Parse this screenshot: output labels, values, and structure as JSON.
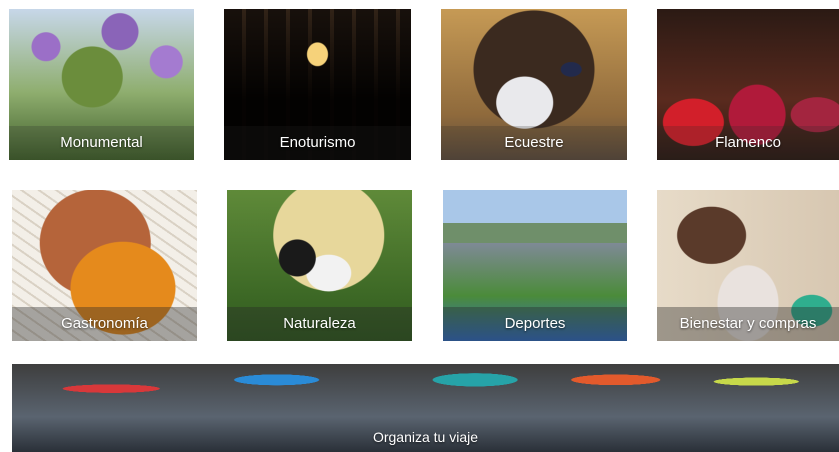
{
  "tiles": [
    {
      "id": "monumental",
      "label": "Monumental"
    },
    {
      "id": "enoturismo",
      "label": "Enoturismo"
    },
    {
      "id": "ecuestre",
      "label": "Ecuestre"
    },
    {
      "id": "flamenco",
      "label": "Flamenco"
    },
    {
      "id": "gastronomia",
      "label": "Gastronomía"
    },
    {
      "id": "naturaleza",
      "label": "Naturaleza"
    },
    {
      "id": "deportes",
      "label": "Deportes"
    },
    {
      "id": "bienestar",
      "label": "Bienestar y compras"
    }
  ],
  "banner": {
    "label": "Organiza tu viaje"
  }
}
